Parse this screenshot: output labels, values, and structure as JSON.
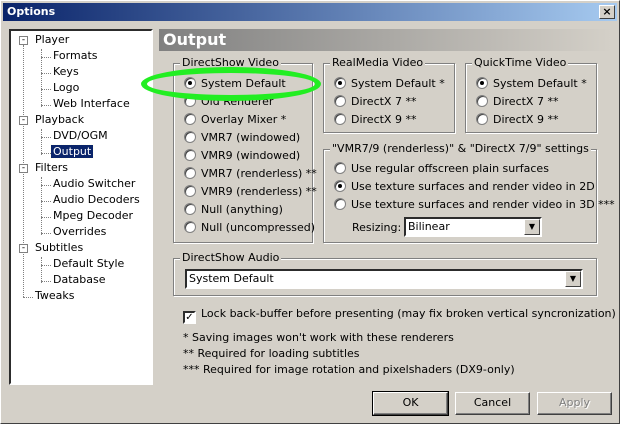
{
  "window": {
    "title": "Options",
    "close_glyph": "×"
  },
  "tree": {
    "items": [
      {
        "label": "Player"
      },
      {
        "label": "Formats"
      },
      {
        "label": "Keys"
      },
      {
        "label": "Logo"
      },
      {
        "label": "Web Interface"
      },
      {
        "label": "Playback"
      },
      {
        "label": "DVD/OGM"
      },
      {
        "label": "Output"
      },
      {
        "label": "Filters"
      },
      {
        "label": "Audio Switcher"
      },
      {
        "label": "Audio Decoders"
      },
      {
        "label": "Mpeg Decoder"
      },
      {
        "label": "Overrides"
      },
      {
        "label": "Subtitles"
      },
      {
        "label": "Default Style"
      },
      {
        "label": "Database"
      },
      {
        "label": "Tweaks"
      }
    ],
    "selected": "Output"
  },
  "page": {
    "title": "Output"
  },
  "directshow_video": {
    "title": "DirectShow Video",
    "options": [
      "System Default",
      "Old Renderer",
      "Overlay Mixer *",
      "VMR7 (windowed)",
      "VMR9 (windowed)",
      "VMR7 (renderless) **",
      "VMR9 (renderless) **",
      "Null (anything)",
      "Null (uncompressed)"
    ],
    "selected_index": 0
  },
  "realmedia_video": {
    "title": "RealMedia Video",
    "options": [
      "System Default *",
      "DirectX 7 **",
      "DirectX 9 **"
    ],
    "selected_index": 0
  },
  "quicktime_video": {
    "title": "QuickTime Video",
    "options": [
      "System Default *",
      "DirectX 7 **",
      "DirectX 9 **"
    ],
    "selected_index": 0
  },
  "vmr_settings": {
    "title": "\"VMR7/9 (renderless)\" & \"DirectX 7/9\" settings",
    "options": [
      "Use regular offscreen plain surfaces",
      "Use texture surfaces and render video in 2D",
      "Use texture surfaces and render video in 3D ***"
    ],
    "selected_index": 1,
    "resizing_label": "Resizing:",
    "resizing_value": "Bilinear"
  },
  "directshow_audio": {
    "title": "DirectShow Audio",
    "value": "System Default"
  },
  "lock_backbuffer": {
    "label": "Lock back-buffer before presenting (may fix broken vertical syncronization)",
    "checked": true,
    "check_glyph": "✓"
  },
  "notes": [
    "* Saving images won't work with these renderers",
    "** Required for loading subtitles",
    "*** Required for image rotation and pixelshaders (DX9-only)"
  ],
  "buttons": {
    "ok": "OK",
    "cancel": "Cancel",
    "apply": "Apply"
  },
  "colors": {
    "highlight": "#22ee22",
    "selection": "#0a246a"
  }
}
